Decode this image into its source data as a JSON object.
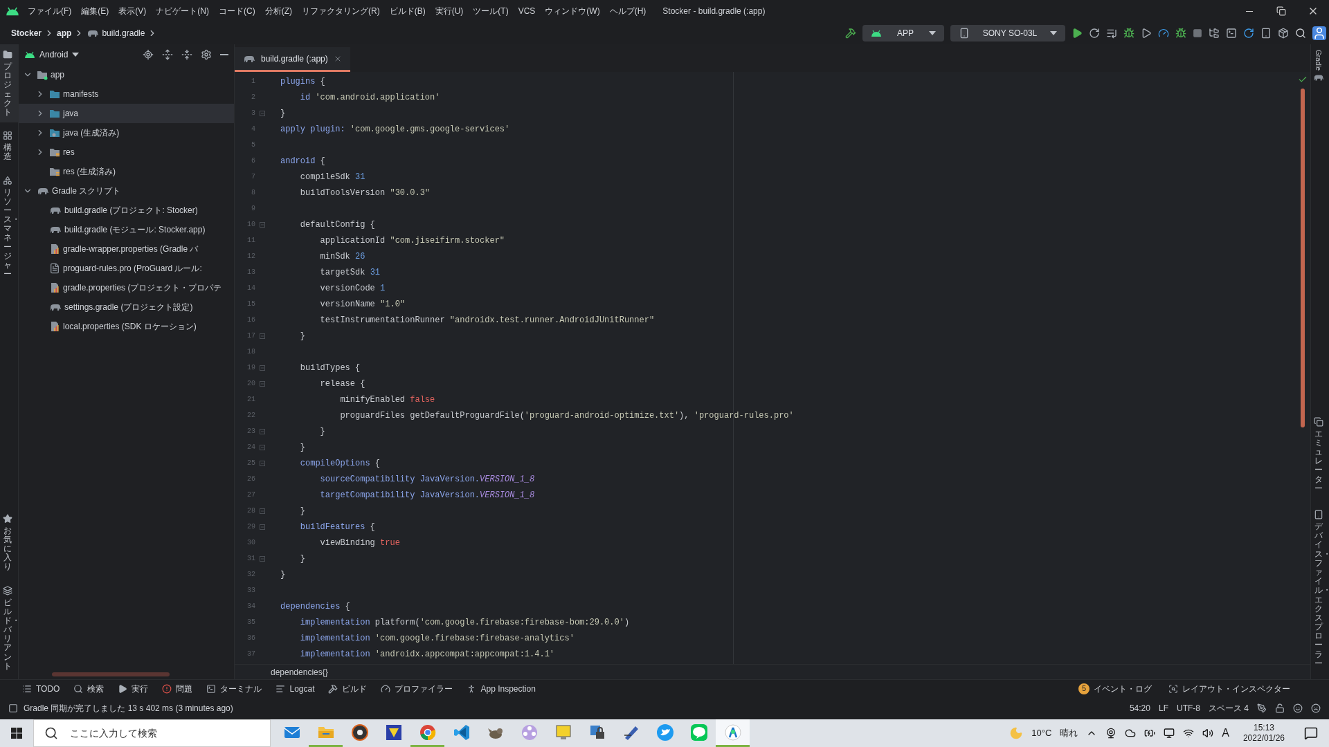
{
  "title_bar": {
    "menu": [
      "ファイル(F)",
      "編集(E)",
      "表示(V)",
      "ナビゲート(N)",
      "コード(C)",
      "分析(Z)",
      "リファクタリング(R)",
      "ビルド(B)",
      "実行(U)",
      "ツール(T)",
      "VCS",
      "ウィンドウ(W)",
      "ヘルプ(H)"
    ],
    "title": "Stocker - build.gradle (:app)"
  },
  "nav_bar": {
    "breadcrumbs": [
      {
        "label": "Stocker",
        "kind": "project"
      },
      {
        "label": "app",
        "kind": "module"
      },
      {
        "label": "build.gradle",
        "kind": "gradle-file"
      }
    ],
    "run_config": "APP",
    "device": "SONY SO-03L"
  },
  "left_tool_strip": {
    "top": [
      {
        "label": "プロジェクト",
        "kind": "folder",
        "selected": true
      },
      {
        "label": "構造",
        "kind": "structure",
        "selected": false
      },
      {
        "label": "リソース・マネージャー",
        "kind": "resources",
        "selected": false
      }
    ],
    "bottom": [
      {
        "label": "お気に入り",
        "kind": "star",
        "selected": false
      },
      {
        "label": "ビルド・バリアント",
        "kind": "variants",
        "selected": false
      }
    ]
  },
  "right_tool_strip": {
    "top": [
      {
        "label": "Gradle",
        "kind": "gradle"
      }
    ],
    "bottom": [
      {
        "label": "エミュレーター",
        "kind": "emulator"
      },
      {
        "label": "デバイス・ファイル・エクスプローラー",
        "kind": "device"
      }
    ]
  },
  "project_panel": {
    "view": "Android",
    "tree": [
      {
        "label": "app",
        "kind": "module-folder",
        "expanded": true,
        "selected": false,
        "children": [
          {
            "label": "manifests",
            "kind": "folder",
            "expanded": false,
            "selected": false
          },
          {
            "label": "java",
            "kind": "folder",
            "expanded": false,
            "selected": true
          },
          {
            "label": "java (生成済み)",
            "kind": "generated-folder",
            "expanded": false,
            "selected": false
          },
          {
            "label": "res",
            "kind": "res-folder",
            "expanded": false,
            "selected": false
          },
          {
            "label": "res (生成済み)",
            "kind": "res-folder",
            "selected": false
          }
        ]
      },
      {
        "label": "Gradle スクリプト",
        "kind": "gradle-group",
        "expanded": true,
        "selected": false,
        "children": [
          {
            "label": "build.gradle (プロジェクト: Stocker)",
            "kind": "gradle",
            "selected": false
          },
          {
            "label": "build.gradle (モジュール: Stocker.app)",
            "kind": "gradle",
            "selected": false
          },
          {
            "label": "gradle-wrapper.properties (Gradle バ",
            "kind": "properties",
            "selected": false
          },
          {
            "label": "proguard-rules.pro (ProGuard ルール:",
            "kind": "text",
            "selected": false
          },
          {
            "label": "gradle.properties (プロジェクト・プロパテ",
            "kind": "properties",
            "selected": false
          },
          {
            "label": "settings.gradle (プロジェクト設定)",
            "kind": "gradle",
            "selected": false
          },
          {
            "label": "local.properties (SDK ロケーション)",
            "kind": "properties",
            "selected": false
          }
        ]
      }
    ]
  },
  "editor": {
    "tabs": [
      {
        "label": "build.gradle (:app)",
        "selected": true
      }
    ],
    "lines": [
      {
        "number": "1",
        "tokens": [
          {
            "kind": "kw",
            "text": "plugins"
          },
          {
            "kind": "plain",
            "text": " {"
          }
        ]
      },
      {
        "number": "2",
        "tokens": [
          {
            "kind": "kw",
            "text": "    id "
          },
          {
            "kind": "str",
            "text": "'com.android.application'"
          }
        ]
      },
      {
        "number": "3",
        "fold": true,
        "tokens": [
          {
            "kind": "plain",
            "text": "}"
          }
        ]
      },
      {
        "number": "4",
        "tokens": [
          {
            "kind": "kw",
            "text": "apply plugin: "
          },
          {
            "kind": "str",
            "text": "'com.google.gms.google-services'"
          }
        ]
      },
      {
        "number": "5"
      },
      {
        "number": "6",
        "tokens": [
          {
            "kind": "kw",
            "text": "android"
          },
          {
            "kind": "plain",
            "text": " {"
          }
        ]
      },
      {
        "number": "7",
        "tokens": [
          {
            "kind": "plain",
            "text": "    compileSdk "
          },
          {
            "kind": "num",
            "text": "31"
          }
        ]
      },
      {
        "number": "8",
        "tokens": [
          {
            "kind": "plain",
            "text": "    buildToolsVersion "
          },
          {
            "kind": "str",
            "text": "\"30.0.3\""
          }
        ]
      },
      {
        "number": "9"
      },
      {
        "number": "10",
        "fold": true,
        "tokens": [
          {
            "kind": "plain",
            "text": "    defaultConfig {"
          }
        ]
      },
      {
        "number": "11",
        "tokens": [
          {
            "kind": "plain",
            "text": "        applicationId "
          },
          {
            "kind": "str",
            "text": "\"com.jiseifirm.stocker\""
          }
        ]
      },
      {
        "number": "12",
        "tokens": [
          {
            "kind": "plain",
            "text": "        minSdk "
          },
          {
            "kind": "num",
            "text": "26"
          }
        ]
      },
      {
        "number": "13",
        "tokens": [
          {
            "kind": "plain",
            "text": "        targetSdk "
          },
          {
            "kind": "num",
            "text": "31"
          }
        ]
      },
      {
        "number": "14",
        "tokens": [
          {
            "kind": "plain",
            "text": "        versionCode "
          },
          {
            "kind": "num",
            "text": "1"
          }
        ]
      },
      {
        "number": "15",
        "tokens": [
          {
            "kind": "plain",
            "text": "        versionName "
          },
          {
            "kind": "str",
            "text": "\"1.0\""
          }
        ]
      },
      {
        "number": "16",
        "tokens": [
          {
            "kind": "plain",
            "text": "        testInstrumentationRunner "
          },
          {
            "kind": "str",
            "text": "\"androidx.test.runner.AndroidJUnitRunner\""
          }
        ]
      },
      {
        "number": "17",
        "fold": true,
        "tokens": [
          {
            "kind": "plain",
            "text": "    }"
          }
        ]
      },
      {
        "number": "18"
      },
      {
        "number": "19",
        "fold": true,
        "tokens": [
          {
            "kind": "plain",
            "text": "    buildTypes {"
          }
        ]
      },
      {
        "number": "20",
        "fold": true,
        "tokens": [
          {
            "kind": "plain",
            "text": "        release {"
          }
        ]
      },
      {
        "number": "21",
        "tokens": [
          {
            "kind": "plain",
            "text": "            minifyEnabled "
          },
          {
            "kind": "bool",
            "text": "false"
          }
        ]
      },
      {
        "number": "22",
        "tokens": [
          {
            "kind": "plain",
            "text": "            proguardFiles getDefaultProguardFile("
          },
          {
            "kind": "str",
            "text": "'proguard-android-optimize.txt'"
          },
          {
            "kind": "plain",
            "text": "), "
          },
          {
            "kind": "str",
            "text": "'proguard-rules.pro'"
          }
        ]
      },
      {
        "number": "23",
        "fold": true,
        "tokens": [
          {
            "kind": "plain",
            "text": "        }"
          }
        ]
      },
      {
        "number": "24",
        "fold": true,
        "tokens": [
          {
            "kind": "plain",
            "text": "    }"
          }
        ]
      },
      {
        "number": "25",
        "fold": true,
        "tokens": [
          {
            "kind": "kw",
            "text": "    compileOptions"
          },
          {
            "kind": "plain",
            "text": " {"
          }
        ]
      },
      {
        "number": "26",
        "tokens": [
          {
            "kind": "kw",
            "text": "        sourceCompatibility JavaVersion."
          },
          {
            "kind": "const",
            "text": "VERSION_1_8"
          }
        ]
      },
      {
        "number": "27",
        "tokens": [
          {
            "kind": "kw",
            "text": "        targetCompatibility JavaVersion."
          },
          {
            "kind": "const",
            "text": "VERSION_1_8"
          }
        ]
      },
      {
        "number": "28",
        "fold": true,
        "tokens": [
          {
            "kind": "plain",
            "text": "    }"
          }
        ]
      },
      {
        "number": "29",
        "fold": true,
        "tokens": [
          {
            "kind": "kw",
            "text": "    buildFeatures"
          },
          {
            "kind": "plain",
            "text": " {"
          }
        ]
      },
      {
        "number": "30",
        "tokens": [
          {
            "kind": "plain",
            "text": "        viewBinding "
          },
          {
            "kind": "bool",
            "text": "true"
          }
        ]
      },
      {
        "number": "31",
        "fold": true,
        "tokens": [
          {
            "kind": "plain",
            "text": "    }"
          }
        ]
      },
      {
        "number": "32",
        "tokens": [
          {
            "kind": "plain",
            "text": "}"
          }
        ]
      },
      {
        "number": "33"
      },
      {
        "number": "34",
        "tokens": [
          {
            "kind": "kw",
            "text": "dependencies"
          },
          {
            "kind": "plain",
            "text": " {"
          }
        ]
      },
      {
        "number": "35",
        "tokens": [
          {
            "kind": "kw",
            "text": "    implementation"
          },
          {
            "kind": "plain",
            "text": " platform("
          },
          {
            "kind": "str",
            "text": "'com.google.firebase:firebase-bom:29.0.0'"
          },
          {
            "kind": "plain",
            "text": ")"
          }
        ]
      },
      {
        "number": "36",
        "tokens": [
          {
            "kind": "kw",
            "text": "    implementation "
          },
          {
            "kind": "str",
            "text": "'com.google.firebase:firebase-analytics'"
          }
        ]
      },
      {
        "number": "37",
        "tokens": [
          {
            "kind": "kw",
            "text": "    implementation "
          },
          {
            "kind": "str",
            "text": "'androidx.appcompat:appcompat:1.4.1'"
          }
        ]
      }
    ],
    "breadcrumb": "dependencies{}"
  },
  "tool_windows": {
    "left": [
      {
        "label": "TODO",
        "kind": "todo"
      },
      {
        "label": "検索",
        "kind": "search"
      },
      {
        "label": "実行",
        "kind": "run"
      },
      {
        "label": "問題",
        "kind": "problems"
      },
      {
        "label": "ターミナル",
        "kind": "terminal"
      },
      {
        "label": "Logcat",
        "kind": "logcat"
      },
      {
        "label": "ビルド",
        "kind": "build"
      },
      {
        "label": "プロファイラー",
        "kind": "profiler"
      },
      {
        "label": "App Inspection",
        "kind": "inspection"
      }
    ],
    "right": [
      {
        "label": "イベント・ログ",
        "kind": "event-log",
        "badge": "5"
      },
      {
        "label": "レイアウト・インスペクター",
        "kind": "layout"
      }
    ]
  },
  "status_bar": {
    "message": "Gradle 同期が完了しました 13 s 402 ms (3 minutes ago)",
    "position": "54:20",
    "line_separator": "LF",
    "encoding": "UTF-8",
    "indent": "スペース 4"
  },
  "taskbar": {
    "search_placeholder": "ここに入力して検索",
    "apps": [
      {
        "kind": "mail",
        "running": false,
        "selected": false
      },
      {
        "kind": "files",
        "running": true,
        "selected": false
      },
      {
        "kind": "disc",
        "running": false,
        "selected": false
      },
      {
        "kind": "square",
        "running": false,
        "selected": false
      },
      {
        "kind": "browser",
        "running": true,
        "selected": false
      },
      {
        "kind": "code",
        "running": false,
        "selected": false
      },
      {
        "kind": "animal",
        "running": false,
        "selected": false
      },
      {
        "kind": "reel",
        "running": false,
        "selected": false
      },
      {
        "kind": "monitor",
        "running": false,
        "selected": false
      },
      {
        "kind": "lock",
        "running": false,
        "selected": false
      },
      {
        "kind": "pen",
        "running": false,
        "selected": false
      },
      {
        "kind": "bird",
        "running": false,
        "selected": false
      },
      {
        "kind": "chat",
        "running": false,
        "selected": false
      },
      {
        "kind": "studio",
        "running": true,
        "selected": true
      }
    ],
    "weather": {
      "temperature": "10°C",
      "condition": "晴れ"
    },
    "ime": "A",
    "time": "15:13",
    "date": "2022/01/26"
  }
}
